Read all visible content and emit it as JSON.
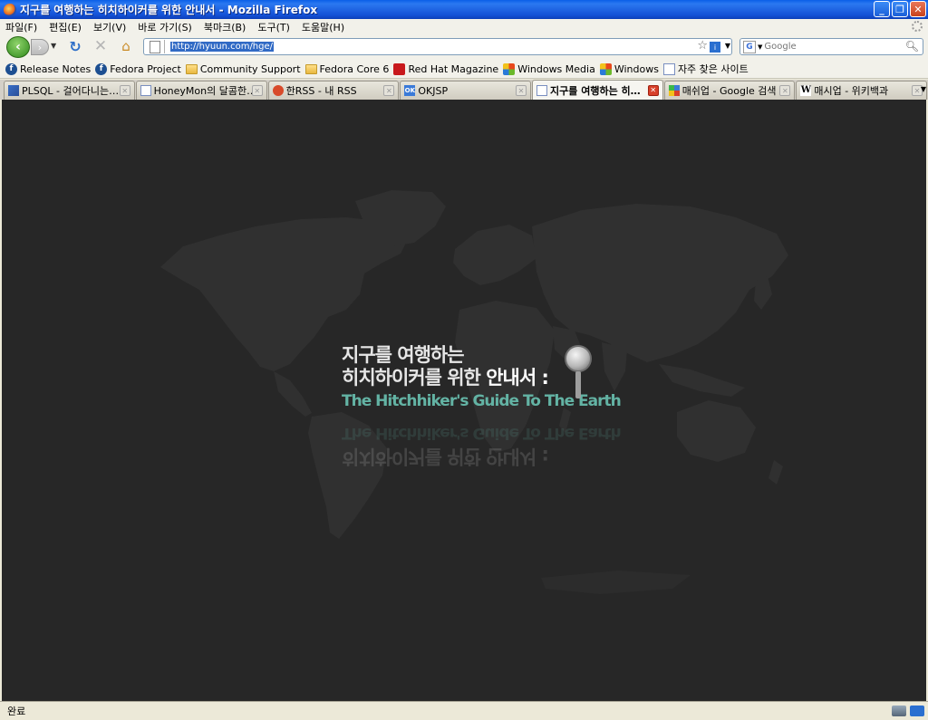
{
  "window": {
    "title": "지구를 여행하는 히치하이커를 위한 안내서 - Mozilla Firefox"
  },
  "menu": [
    "파일(F)",
    "편집(E)",
    "보기(V)",
    "바로 가기(S)",
    "북마크(B)",
    "도구(T)",
    "도움말(H)"
  ],
  "nav": {
    "url": "http://hyuun.com/hge/",
    "search_placeholder": "Google"
  },
  "bookmarks": [
    {
      "label": "Release Notes",
      "icon": "fedora-icon"
    },
    {
      "label": "Fedora Project",
      "icon": "fedora-icon"
    },
    {
      "label": "Community Support",
      "icon": "folder-icon"
    },
    {
      "label": "Fedora Core 6",
      "icon": "folder-icon"
    },
    {
      "label": "Red Hat Magazine",
      "icon": "redhat-icon"
    },
    {
      "label": "Windows Media",
      "icon": "windows-icon"
    },
    {
      "label": "Windows",
      "icon": "windows-icon"
    },
    {
      "label": "자주 찾은 사이트",
      "icon": "page-icon"
    }
  ],
  "tabs": [
    {
      "label": "PLSQL - 걸어다니는…",
      "icon": "plsql-icon",
      "active": false
    },
    {
      "label": "HoneyMon의 달콤한…",
      "icon": "page-icon",
      "active": false
    },
    {
      "label": "한RSS - 내 RSS",
      "icon": "rss-icon",
      "active": false
    },
    {
      "label": "OKJSP",
      "icon": "okjsp-icon",
      "active": false
    },
    {
      "label": "지구를 여행하는 히…",
      "icon": "page-icon",
      "active": true
    },
    {
      "label": "매쉬업 - Google 검색",
      "icon": "google-icon",
      "active": false
    },
    {
      "label": "매시업 - 위키백과",
      "icon": "wikipedia-icon",
      "active": false
    }
  ],
  "content": {
    "line1": "지구를 여행하는",
    "line2_a": "히치하이커를 위한",
    "line2_b": "안내서 :",
    "english": "The Hitchhiker's Guide To The Earth"
  },
  "status": {
    "text": "완료"
  },
  "colors": {
    "background": "#272727",
    "map_land": "#313131",
    "english_title": "#63b3a4"
  }
}
